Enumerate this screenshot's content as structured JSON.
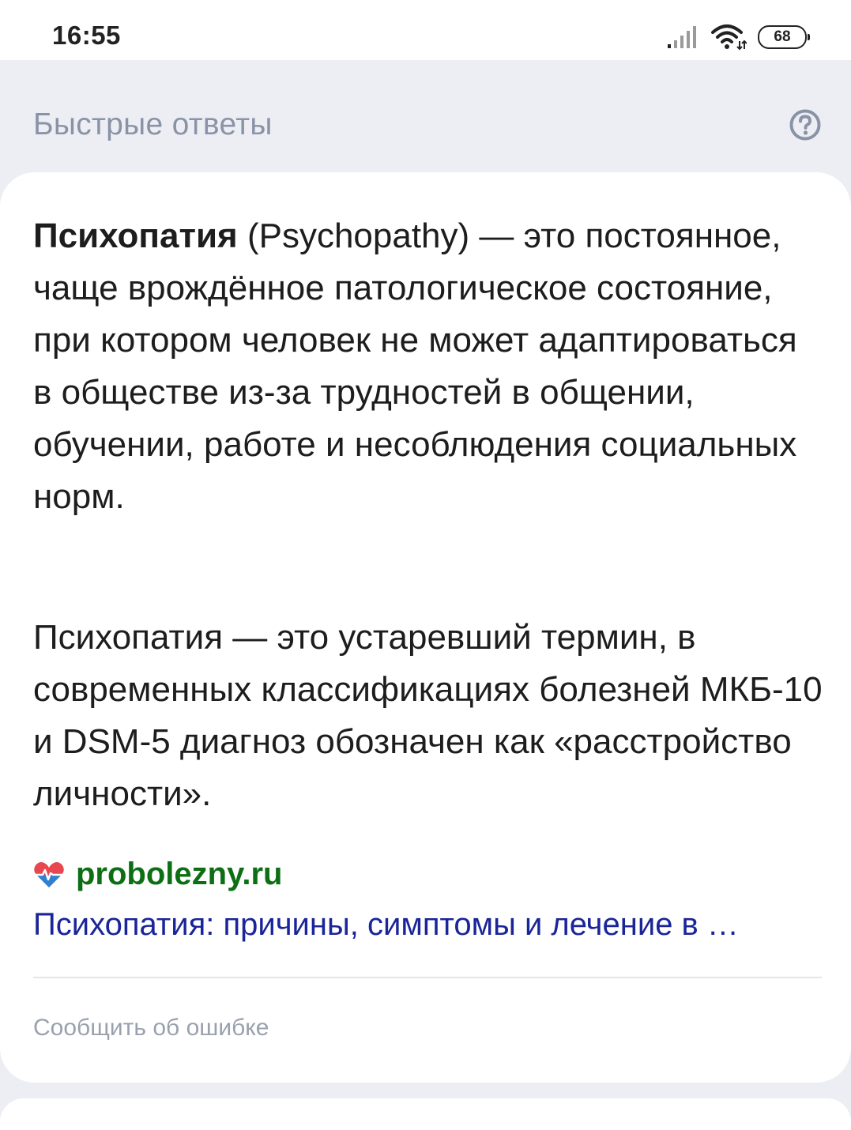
{
  "status_bar": {
    "time": "16:55",
    "battery": "68",
    "icons": [
      "signal-icon",
      "wifi-icon",
      "battery-icon"
    ]
  },
  "header": {
    "title": "Быстрые ответы",
    "help_icon": "question-circle-icon"
  },
  "answer": {
    "term": "Психопатия",
    "paragraph1_rest": " (Psychopathy) — это постоянное, чаще врождённое патологическое состояние, при котором человек не может адаптироваться в обществе из-за трудностей в общении, обучении, работе и несоблюдения социальных норм.",
    "paragraph2": "Психопатия — это устаревший термин, в современных классификациях болезней МКБ-10 и DSM-5 диагноз обозначен как «расстройство личности»."
  },
  "source": {
    "icon": "heart-pulse-icon",
    "site": "probolezny.ru",
    "link_text": "Психопатия: причины, симптомы и лечение в …"
  },
  "footer": {
    "report_label": "Сообщить об ошибке"
  },
  "colors": {
    "page_bg": "#eceef3",
    "card_bg": "#ffffff",
    "header_text": "#8a93a6",
    "source_green": "#0d6f14",
    "link_blue": "#1a2599",
    "muted_text": "#9aa1ae"
  }
}
